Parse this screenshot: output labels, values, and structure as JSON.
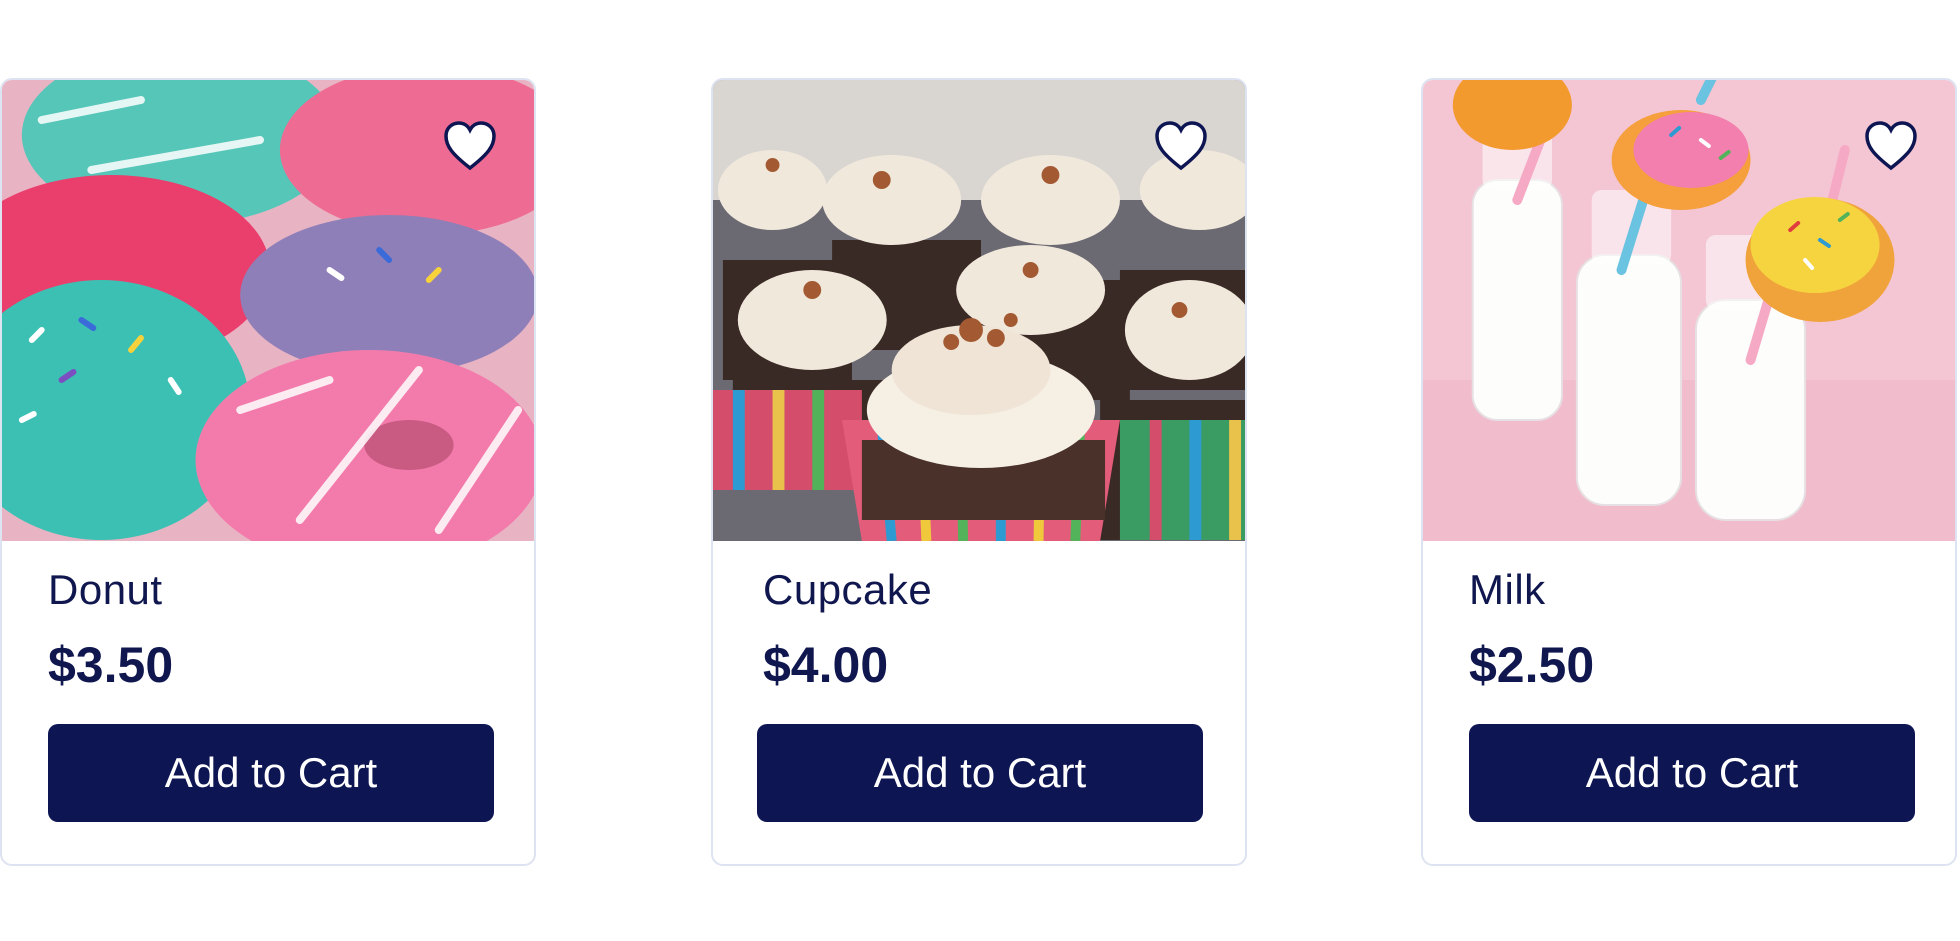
{
  "products": [
    {
      "name": "Donut",
      "price": "$3.50",
      "button_label": "Add to Cart",
      "image": "donuts-photo"
    },
    {
      "name": "Cupcake",
      "price": "$4.00",
      "button_label": "Add to Cart",
      "image": "cupcakes-photo"
    },
    {
      "name": "Milk",
      "price": "$2.50",
      "button_label": "Add to Cart",
      "image": "milk-and-donuts-photo"
    }
  ],
  "colors": {
    "navy": "#0d1552",
    "card_border": "#dde3f0",
    "text": "#10174f"
  },
  "icons": {
    "favorite": "heart-icon"
  }
}
